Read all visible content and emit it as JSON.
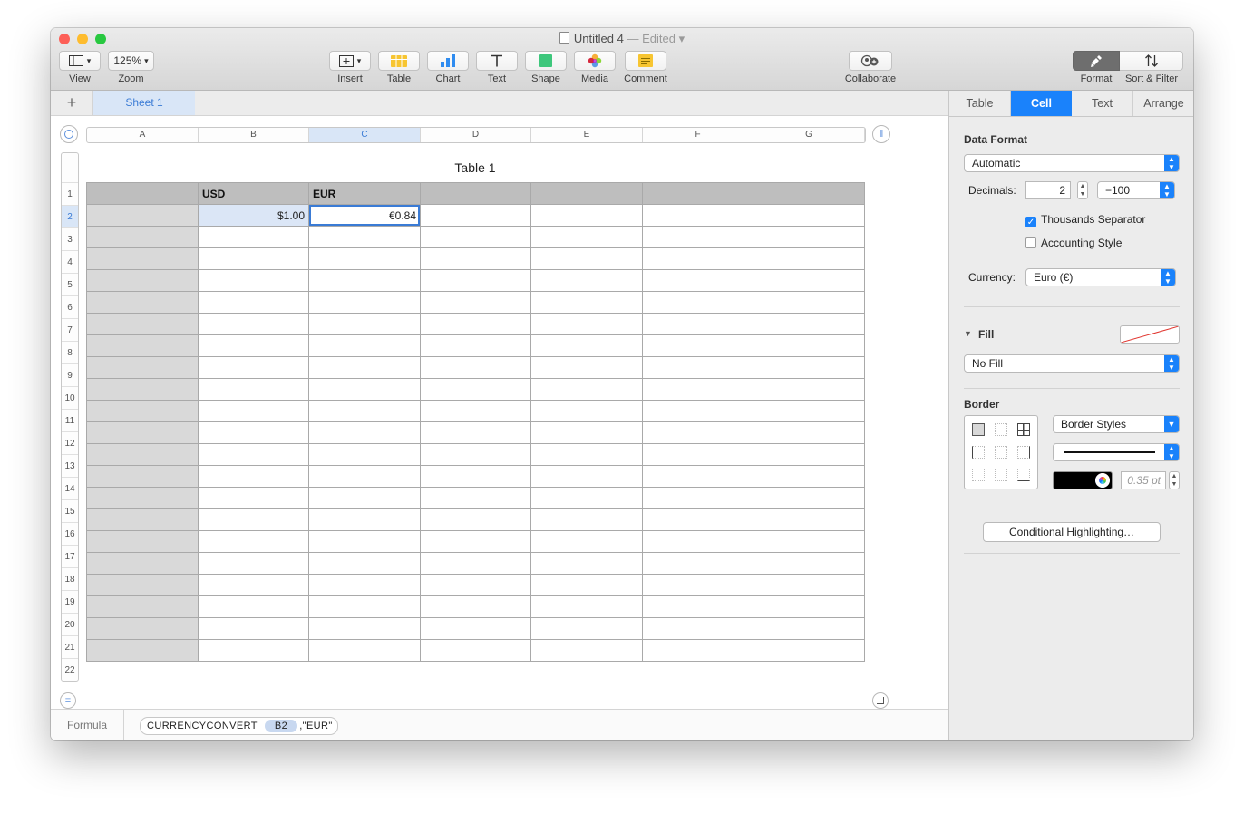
{
  "window": {
    "title": "Untitled 4",
    "status": "— Edited"
  },
  "toolbar": {
    "view": {
      "label": "View"
    },
    "zoom": {
      "value": "125%",
      "label": "Zoom"
    },
    "insert": {
      "label": "Insert"
    },
    "table": {
      "label": "Table"
    },
    "chart": {
      "label": "Chart"
    },
    "text": {
      "label": "Text"
    },
    "shape": {
      "label": "Shape"
    },
    "media": {
      "label": "Media"
    },
    "comment": {
      "label": "Comment"
    },
    "collaborate": {
      "label": "Collaborate"
    },
    "format": {
      "label": "Format"
    },
    "sort_filter": {
      "label": "Sort & Filter"
    }
  },
  "sheets": {
    "add": "+",
    "tabs": [
      "Sheet 1"
    ],
    "active": "Sheet 1"
  },
  "spreadsheet": {
    "table_title": "Table 1",
    "columns": [
      "A",
      "B",
      "C",
      "D",
      "E",
      "F",
      "G"
    ],
    "selected_column": "C",
    "row_count": 22,
    "selected_row": 2,
    "header_row": [
      "",
      "USD",
      "EUR",
      "",
      "",
      "",
      ""
    ],
    "data": {
      "B2": "$1.00",
      "C2": "€0.84"
    }
  },
  "formula": {
    "label": "Formula",
    "function": "CURRENCYCONVERT",
    "arg_ref": "B2",
    "arg_rest": ",\"EUR\""
  },
  "inspector": {
    "tabs": [
      "Table",
      "Cell",
      "Text",
      "Arrange"
    ],
    "active_tab": "Cell",
    "data_format": {
      "title": "Data Format",
      "value": "Automatic",
      "decimals_label": "Decimals:",
      "decimals_value": "2",
      "negative_value": "−100",
      "thousands_separator": {
        "label": "Thousands Separator",
        "checked": true
      },
      "accounting_style": {
        "label": "Accounting Style",
        "checked": false
      },
      "currency_label": "Currency:",
      "currency_value": "Euro (€)"
    },
    "fill": {
      "title": "Fill",
      "value": "No Fill"
    },
    "border": {
      "title": "Border",
      "style": "Border Styles",
      "width": "0.35 pt",
      "color": "#000000"
    },
    "conditional_highlighting": "Conditional Highlighting…"
  },
  "colors": {
    "accent": "#1a82fb",
    "selection": "#3a7bd5",
    "close": "#fd5f57",
    "minimize": "#febc2e",
    "zoom": "#28c840"
  }
}
